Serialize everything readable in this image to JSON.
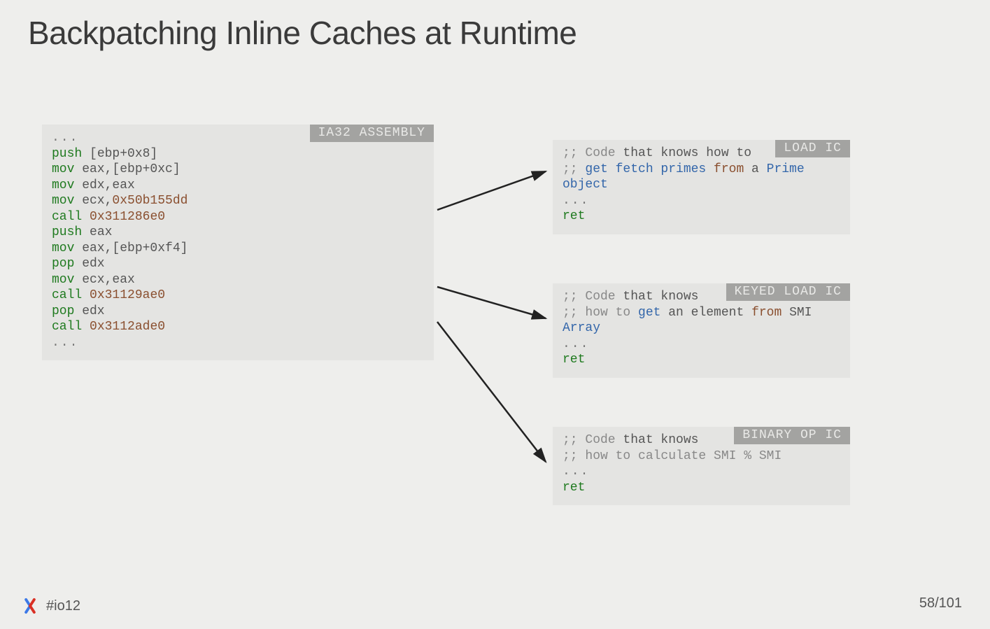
{
  "title": "Backpatching Inline Caches at Runtime",
  "hashtag": "#io12",
  "page": "58/101",
  "asm": {
    "tag": "IA32 ASSEMBLY",
    "lines": [
      {
        "dots": "..."
      },
      {
        "op": "push",
        "rest": " [ebp+0x8]"
      },
      {
        "op": "mov",
        "rest": " eax,[ebp+0xc]"
      },
      {
        "op": "mov",
        "rest": " edx,eax"
      },
      {
        "op": "mov",
        "pre": " ecx,",
        "addr": "0x50b155dd"
      },
      {
        "op": "call",
        "pre": " ",
        "addr": "0x311286e0"
      },
      {
        "op": "push",
        "rest": " eax"
      },
      {
        "op": "mov",
        "rest": " eax,[ebp+0xf4]"
      },
      {
        "op": "pop",
        "rest": " edx"
      },
      {
        "op": "mov",
        "rest": " ecx,eax"
      },
      {
        "op": "call",
        "pre": " ",
        "addr": "0x31129ae0"
      },
      {
        "op": "pop",
        "rest": " edx"
      },
      {
        "op": "call",
        "pre": " ",
        "addr": "0x3112ade0"
      },
      {
        "dots": "..."
      }
    ]
  },
  "ic": [
    {
      "tag": "LOAD IC",
      "c1a": ";; Code",
      "c1b": " that knows how to",
      "c2a": ";; ",
      "c2b": "get fetch primes",
      "c2c": " from",
      "c2d": " a ",
      "c2e": "Prime object",
      "ret": "ret"
    },
    {
      "tag": "KEYED LOAD IC",
      "c1a": ";; Code",
      "c1b": " that knows",
      "c2a": ";; how to ",
      "c2b": "get",
      "c2c": " an element ",
      "c2d": "from",
      "c2e": " SMI ",
      "c2f": "Array",
      "ret": "ret"
    },
    {
      "tag": "BINARY OP IC",
      "c1a": ";; Code",
      "c1b": " that knows",
      "c2a": ";; how to calculate SMI % SMI",
      "ret": "ret"
    }
  ]
}
